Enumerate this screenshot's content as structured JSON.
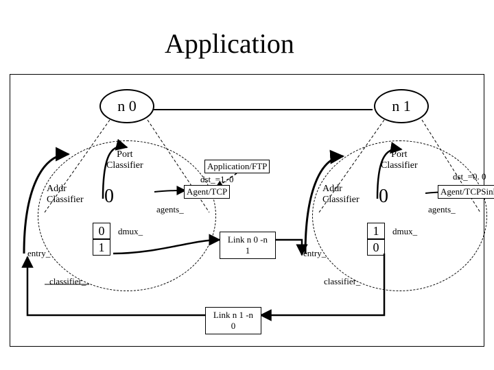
{
  "title": "Application",
  "nodes": {
    "n0": "n 0",
    "n1": "n 1"
  },
  "left": {
    "port": "Port\nClassifier",
    "addr": "Addr\nClassifier",
    "zero": "0",
    "port_zero": "0",
    "port_one": "1",
    "dmux": "dmux_",
    "agents": "agents_",
    "classifier": "classifier_",
    "entry": "entry_",
    "dst": "dst_=1. 0",
    "agent": "Agent/TCP",
    "app": "Application/FTP"
  },
  "right": {
    "port": "Port\nClassifier",
    "addr": "Addr\nClassifier",
    "zero": "0",
    "port_zero": "1",
    "port_one": "0",
    "dmux": "dmux_",
    "agents": "agents_",
    "classifier": "classifier_",
    "entry": "entry_",
    "dst": "dst_=0. 0",
    "agent": "Agent/TCPSink"
  },
  "links": {
    "l01": "Link n 0 -n 1",
    "l10": "Link n 1 -n 0"
  },
  "chart_data": {
    "type": "diagram",
    "title": "Application",
    "nodes": [
      {
        "id": "n0",
        "label": "n 0",
        "components": {
          "port_classifier": {
            "slots": [
              "0",
              "1"
            ]
          },
          "addr_classifier": {
            "slots": [
              "0"
            ]
          },
          "agent": "Agent/TCP",
          "application": "Application/FTP",
          "dst": "1.0"
        }
      },
      {
        "id": "n1",
        "label": "n 1",
        "components": {
          "port_classifier": {
            "slots": [
              "1",
              "0"
            ]
          },
          "addr_classifier": {
            "slots": [
              "0"
            ]
          },
          "agent": "Agent/TCPSink",
          "dst": "0.0"
        }
      }
    ],
    "links": [
      {
        "from": "n0",
        "to": "n1",
        "label": "Link n 0 -n 1"
      },
      {
        "from": "n1",
        "to": "n0",
        "label": "Link n 1 -n 0"
      }
    ],
    "annotations": [
      "entry_",
      "classifier_",
      "dmux_",
      "agents_"
    ]
  }
}
